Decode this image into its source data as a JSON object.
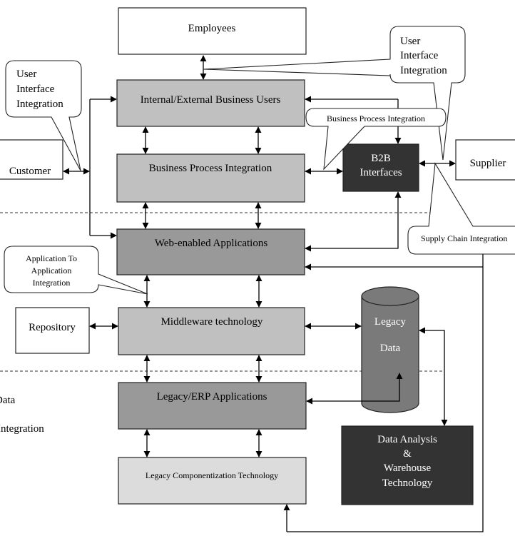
{
  "colors": {
    "light_gray": "#c0c0c0",
    "mid_gray": "#999999",
    "pale_gray": "#dcdcdc",
    "dark": "#333333",
    "cylinder": "#7a7a7a"
  },
  "boxes": {
    "employees": "Employees",
    "business_users": "Internal/External Business Users",
    "bpi": "Business Process Integration",
    "web_apps": "Web-enabled Applications",
    "middleware": "Middleware technology",
    "legacy_erp": "Legacy/ERP Applications",
    "legacy_comp": "Legacy Componentization Technology",
    "customer": "Customer",
    "repository": "Repository",
    "supplier": "Supplier",
    "b2b": [
      "B2B",
      "Interfaces"
    ],
    "legacy_data": [
      "Legacy",
      "Data"
    ],
    "data_analysis": [
      "Data Analysis",
      "&",
      "Warehouse",
      "Technology"
    ]
  },
  "callouts": {
    "ui_left": [
      "User",
      "Interface",
      "Integration"
    ],
    "ui_right": [
      "User",
      "Interface",
      "Integration"
    ],
    "bpi": "Business Process Integration",
    "supply_chain": "Supply Chain  Integration",
    "app_to_app": [
      "Application To",
      "Application",
      "Integration"
    ]
  },
  "side_labels": [
    "Data",
    "Integration"
  ]
}
